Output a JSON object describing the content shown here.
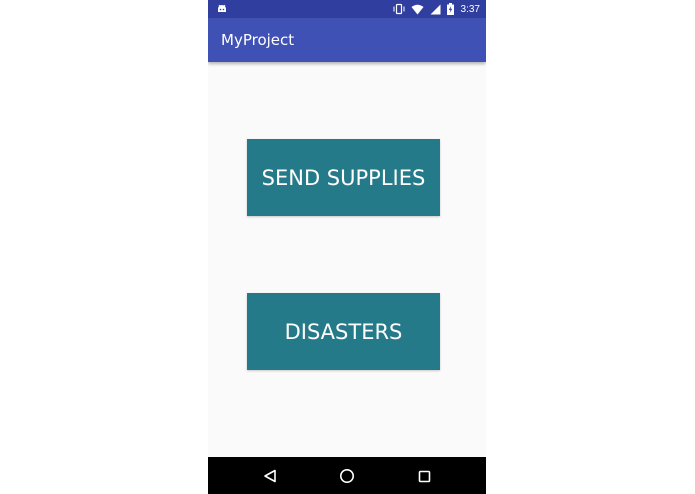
{
  "status_bar": {
    "time": "3:37",
    "left_icon": "android-notification-icon",
    "right_icons": [
      "vibrate-icon",
      "wifi-icon",
      "signal-icon",
      "battery-charging-icon"
    ]
  },
  "app_bar": {
    "title": "MyProject"
  },
  "main": {
    "buttons": [
      {
        "label": "SEND SUPPLIES"
      },
      {
        "label": "DISASTERS"
      }
    ],
    "button_color": "#247a89"
  },
  "nav_bar": {
    "icons": [
      "back-icon",
      "home-icon",
      "recents-icon"
    ]
  },
  "colors": {
    "status_bar": "#303f9f",
    "app_bar": "#3f51b5",
    "background": "#fafafa",
    "nav_bar": "#000000"
  }
}
